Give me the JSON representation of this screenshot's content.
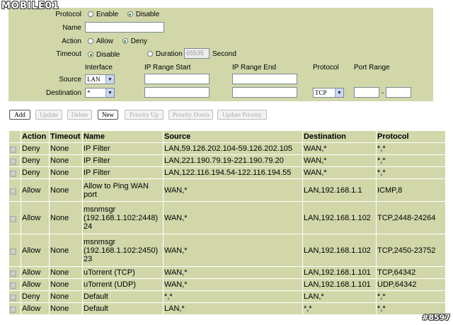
{
  "watermark": {
    "logo": "MOBILE01",
    "tag": "#8597"
  },
  "form": {
    "protocol_label": "Protocol",
    "protocol_options": {
      "enable": "Enable",
      "disable": "Disable"
    },
    "name_label": "Name",
    "name_value": "",
    "action_label": "Action",
    "action_options": {
      "allow": "Allow",
      "deny": "Deny"
    },
    "timeout_label": "Timeout",
    "timeout_options": {
      "disable": "Disable",
      "duration": "Duration"
    },
    "duration_value": "65535",
    "second_label": "Second",
    "col_interface": "Interface",
    "col_range_start": "IP Range Start",
    "col_range_end": "IP Range End",
    "col_protocol": "Protocol",
    "col_port_range": "Port Range",
    "source_label": "Source",
    "source_interface": "LAN",
    "destination_label": "Destination",
    "destination_interface": "*",
    "destination_protocol": "TCP",
    "port_separator": "-"
  },
  "buttons": {
    "add": "Add",
    "update": "Update",
    "delete": "Delete",
    "new": "New",
    "priority_up": "Priority Up",
    "priority_down": "Priority Down",
    "update_priority": "Update Priority"
  },
  "table": {
    "headers": {
      "action": "Action",
      "timeout": "Timeout",
      "name": "Name",
      "source": "Source",
      "destination": "Destination",
      "protocol": "Protocol"
    },
    "rows": [
      {
        "action": "Deny",
        "timeout": "None",
        "name": "IP Filter",
        "source": "LAN,59.126.202.104-59.126.202.105",
        "destination": "WAN,*",
        "protocol": "*,*"
      },
      {
        "action": "Deny",
        "timeout": "None",
        "name": "IP Filter",
        "source": "LAN,221.190.79.19-221.190.79.20",
        "destination": "WAN,*",
        "protocol": "*,*"
      },
      {
        "action": "Deny",
        "timeout": "None",
        "name": "IP Filter",
        "source": "LAN,122.116.194.54-122.116.194.55",
        "destination": "WAN,*",
        "protocol": "*,*"
      },
      {
        "action": "Allow",
        "timeout": "None",
        "name": "Allow to Ping WAN port",
        "source": "WAN,*",
        "destination": "LAN,192.168.1.1",
        "protocol": "ICMP,8"
      },
      {
        "action": "Allow",
        "timeout": "None",
        "name": "msnmsgr (192.168.1.102:2448) 24",
        "source": "WAN,*",
        "destination": "LAN,192.168.1.102",
        "protocol": "TCP,2448-24264"
      },
      {
        "action": "Allow",
        "timeout": "None",
        "name": "msnmsgr (192.168.1.102:2450) 23",
        "source": "WAN,*",
        "destination": "LAN,192.168.1.102",
        "protocol": "TCP,2450-23752"
      },
      {
        "action": "Allow",
        "timeout": "None",
        "name": "uTorrent (TCP)",
        "source": "WAN,*",
        "destination": "LAN,192.168.1.101",
        "protocol": "TCP,64342"
      },
      {
        "action": "Allow",
        "timeout": "None",
        "name": "uTorrent (UDP)",
        "source": "WAN,*",
        "destination": "LAN,192.168.1.101",
        "protocol": "UDP,64342"
      },
      {
        "action": "Deny",
        "timeout": "None",
        "name": "Default",
        "source": "*,*",
        "destination": "LAN,*",
        "protocol": "*,*"
      },
      {
        "action": "Allow",
        "timeout": "None",
        "name": "Default",
        "source": "LAN,*",
        "destination": "*,*",
        "protocol": "*,*"
      }
    ]
  }
}
